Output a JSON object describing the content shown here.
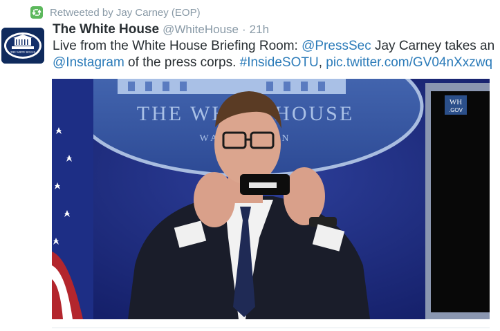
{
  "retweet": {
    "text": "Retweeted by Jay Carney (EOP)",
    "icon": "retweet-icon"
  },
  "avatar": {
    "icon": "white-house-logo",
    "logo_text": "THE WHITE HOUSE"
  },
  "tweet": {
    "name": "The White House",
    "handle": "@WhiteHouse",
    "separator": "·",
    "time": "21h",
    "text_parts": [
      {
        "text": "Live from the White House Briefing Room: ",
        "link": false
      },
      {
        "text": "@PressSec",
        "link": true
      },
      {
        "text": " Jay Carney takes an ",
        "link": false
      },
      {
        "text": "@Instagram",
        "link": true
      },
      {
        "text": " of the press corps. ",
        "link": false
      },
      {
        "text": "#InsideSOTU",
        "link": true
      },
      {
        "text": ", ",
        "link": false
      },
      {
        "text": "pic.twitter.com/GV04nXxzwq",
        "link": true
      }
    ]
  },
  "media": {
    "backdrop_line1": "THE WHITE HOUSE",
    "backdrop_line2": "WASHINGTON",
    "wh_badge_line1": "WH",
    "wh_badge_line2": ".GOV"
  },
  "colors": {
    "link": "#2b7bb9",
    "muted": "#8899a6",
    "retweet": "#5cb85c",
    "backdrop": "#1b2b78"
  }
}
